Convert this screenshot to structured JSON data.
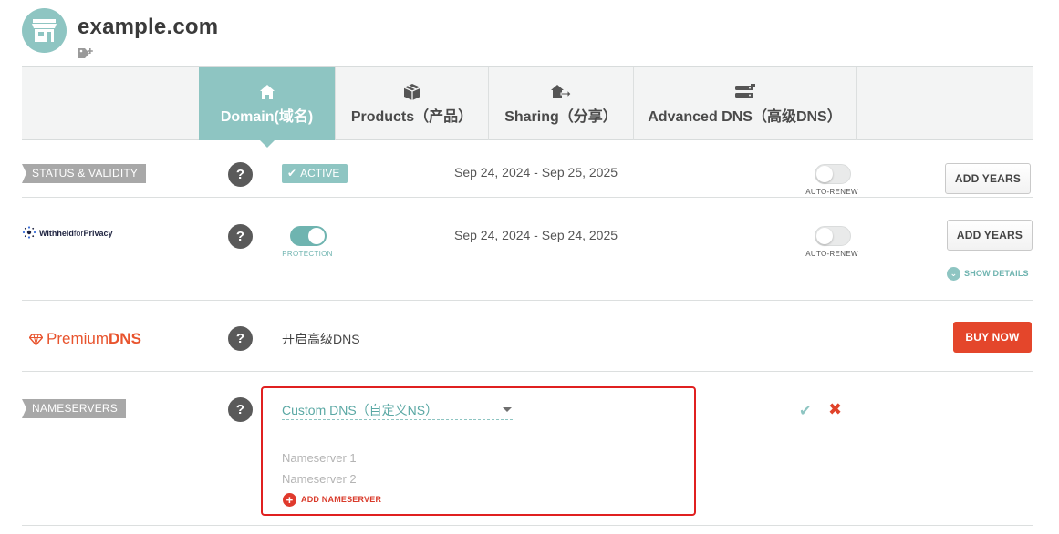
{
  "header": {
    "domain": "example.com",
    "store_icon": "store-icon",
    "tag_icon": "tag-plus-icon"
  },
  "tabs": [
    {
      "label": "Domain(域名)",
      "icon": "home-icon",
      "active": true
    },
    {
      "label": "Products（产品）",
      "icon": "box-icon",
      "active": false
    },
    {
      "label": "Sharing（分享）",
      "icon": "share-icon",
      "active": false
    },
    {
      "label": "Advanced DNS（高级DNS）",
      "icon": "server-icon",
      "active": false
    }
  ],
  "status": {
    "label": "STATUS & VALIDITY",
    "help": "?",
    "badge": "ACTIVE",
    "dates": "Sep 24, 2024 - Sep 25, 2025",
    "auto_renew_label": "AUTO-RENEW",
    "auto_renew_on": false,
    "add_years": "ADD YEARS"
  },
  "privacy": {
    "logo_part1": "Withheld",
    "logo_part2": "for",
    "logo_part3": "Privacy",
    "help": "?",
    "protection_label": "PROTECTION",
    "protection_on": true,
    "dates": "Sep 24, 2024 - Sep 24, 2025",
    "auto_renew_label": "AUTO-RENEW",
    "auto_renew_on": false,
    "add_years": "ADD YEARS",
    "show_details": "SHOW DETAILS"
  },
  "premium_dns": {
    "logo_part1": "Premium",
    "logo_part2": "DNS",
    "help": "?",
    "text": "开启高级DNS",
    "buy_now": "BUY NOW"
  },
  "nameservers": {
    "label": "NAMESERVERS",
    "help": "?",
    "selected": "Custom DNS（自定义NS）",
    "ns1_placeholder": "Nameserver 1",
    "ns2_placeholder": "Nameserver 2",
    "add_nameserver": "ADD NAMESERVER",
    "confirm": "✔",
    "cancel": "✖"
  },
  "colors": {
    "accent": "#8ec5c2",
    "danger": "#e4462b",
    "highlight_border": "#e02020"
  }
}
